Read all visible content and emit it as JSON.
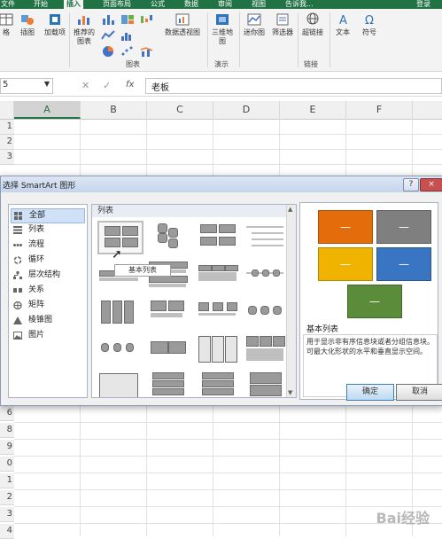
{
  "ribbon": {
    "tabs": [
      "文件",
      "开始",
      "插入",
      "页面布局",
      "公式",
      "数据",
      "审阅",
      "视图",
      "告诉我..."
    ],
    "active_tab": "插入",
    "login": "登录",
    "buttons": {
      "table": "格",
      "illustrations": "插图",
      "addins": "加载项",
      "recommended_charts": "推荐的图表",
      "pivot_chart": "数据透视图",
      "map_3d": "三维地图",
      "sparklines": "迷你图",
      "slicer": "筛选器",
      "hyperlink": "超链接",
      "text": "文本",
      "symbol": "符号"
    },
    "groups": {
      "charts": "图表",
      "tours": "演示",
      "links": "链接"
    }
  },
  "formula_bar": {
    "name_box": "5",
    "fx": "fx",
    "value": "老板"
  },
  "sheet": {
    "columns": [
      "A",
      "B",
      "C",
      "D",
      "E",
      "F"
    ],
    "selected_column": "A",
    "rows_top": [
      "1",
      "2",
      "3"
    ],
    "rows_bottom": [
      "6",
      "8",
      "9",
      "0",
      "1",
      "2",
      "3",
      "4"
    ]
  },
  "dialog": {
    "title": "选择 SmartArt 图形",
    "help": "?",
    "close": "×",
    "categories": [
      {
        "label": "全部",
        "icon": "grid-icon"
      },
      {
        "label": "列表",
        "icon": "list-icon"
      },
      {
        "label": "流程",
        "icon": "process-icon"
      },
      {
        "label": "循环",
        "icon": "cycle-icon"
      },
      {
        "label": "层次结构",
        "icon": "hierarchy-icon"
      },
      {
        "label": "关系",
        "icon": "relationship-icon"
      },
      {
        "label": "矩阵",
        "icon": "matrix-icon"
      },
      {
        "label": "棱锥图",
        "icon": "pyramid-icon"
      },
      {
        "label": "图片",
        "icon": "picture-icon"
      }
    ],
    "selected_category": "全部",
    "layout_header": "列表",
    "tooltip": "基本列表",
    "preview": {
      "title": "基本列表",
      "description": "用于显示非有序信息块或者分组信息块。可最大化形状的水平和垂直显示空间。",
      "box_glyph": "—",
      "colors": [
        "#e46c0a",
        "#7f7f7f",
        "#f0b400",
        "#3a75c4",
        "#5b8c3a"
      ]
    },
    "ok": "确定",
    "cancel": "取消"
  },
  "watermark": "Bai经验"
}
